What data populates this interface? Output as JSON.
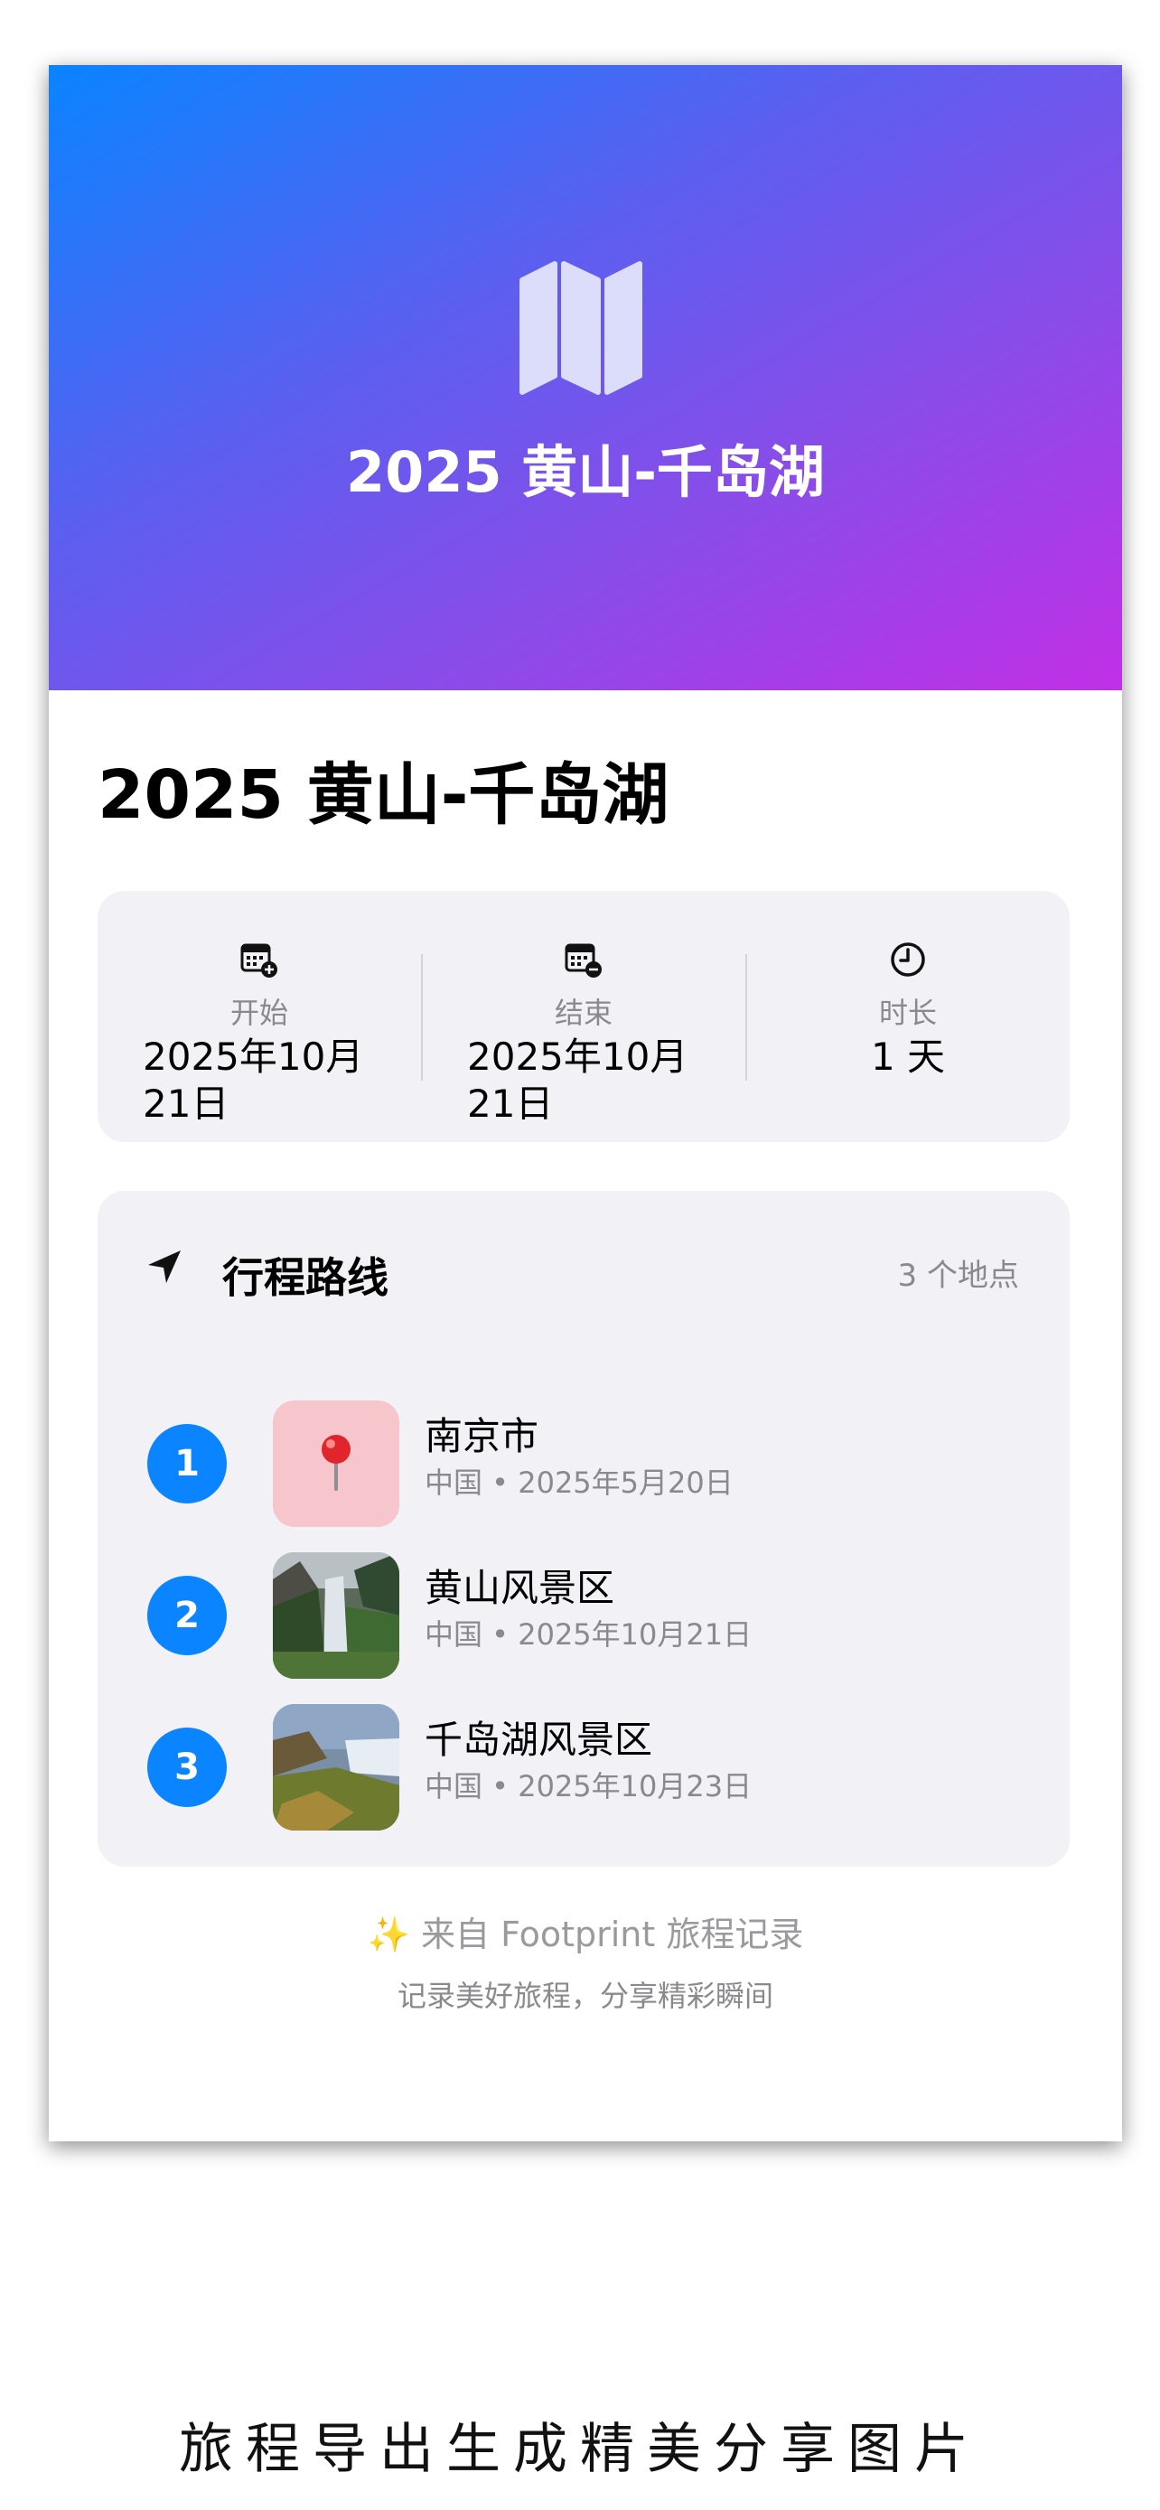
{
  "hero": {
    "title": "2025 黄山-千岛湖",
    "icon": "map-icon"
  },
  "trip": {
    "title": "2025 黄山-千岛湖"
  },
  "info": {
    "start": {
      "icon": "calendar-plus-icon",
      "label": "开始",
      "value_line1": "2025年10月",
      "value_line2": "21日"
    },
    "end": {
      "icon": "calendar-minus-icon",
      "label": "结束",
      "value_line1": "2025年10月",
      "value_line2": "21日"
    },
    "duration": {
      "icon": "clock-icon",
      "label": "时长",
      "value": "1 天"
    }
  },
  "route": {
    "icon": "location-arrow-icon",
    "title": "行程路线",
    "count": "3 个地点",
    "stops": [
      {
        "num": "1",
        "name": "南京市",
        "meta": "中国 • 2025年5月20日",
        "thumb": "pin-icon"
      },
      {
        "num": "2",
        "name": "黄山风景区",
        "meta": "中国 • 2025年10月21日",
        "thumb": "waterfall-photo"
      },
      {
        "num": "3",
        "name": "千岛湖风景区",
        "meta": "中国 • 2025年10月23日",
        "thumb": "falls-photo"
      }
    ]
  },
  "footer": {
    "line1": "✨ 来自 Footprint 旅程记录",
    "line2": "记录美好旅程，分享精彩瞬间"
  },
  "caption": "旅程导出生成精美分享图片",
  "colors": {
    "accent": "#0a84ff",
    "gradient_start": "#0a84ff",
    "gradient_end": "#c130e6",
    "panel": "#f1f1f6"
  }
}
